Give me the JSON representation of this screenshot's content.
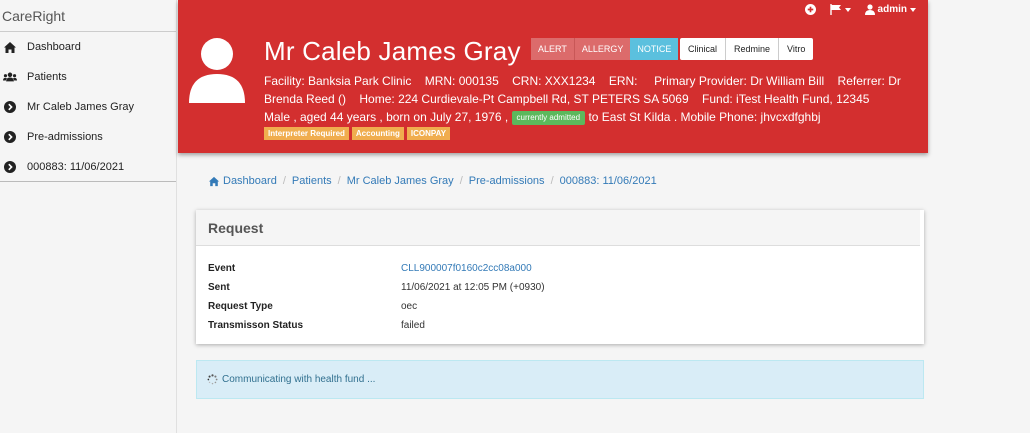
{
  "app": {
    "brand": "CareRight"
  },
  "sidebar": {
    "items": [
      {
        "label": "Dashboard",
        "icon": "home-icon"
      },
      {
        "label": "Patients",
        "icon": "users-icon"
      },
      {
        "label": "Mr Caleb James Gray",
        "icon": "chevron-circle-icon"
      },
      {
        "label": "Pre-admissions",
        "icon": "chevron-circle-icon"
      },
      {
        "label": "000883: 11/06/2021",
        "icon": "chevron-circle-icon"
      }
    ]
  },
  "topbar": {
    "user_label": "admin"
  },
  "patient": {
    "name": "Mr Caleb James Gray",
    "badges": {
      "alert": "ALERT",
      "allergy": "ALLERGY",
      "notice": "NOTICE"
    },
    "tabs": [
      "Clinical",
      "Redmine",
      "Vitro"
    ],
    "facility": "Facility: Banksia Park Clinic",
    "mrn": "MRN: 000135",
    "crn": "CRN: XXX1234",
    "ern": "ERN:",
    "primary_provider": "Primary Provider: Dr William Bill",
    "referrer": "Referrer: Dr Brenda Reed ()",
    "home": "Home: 224 Curdievale-Pt Campbell Rd, ST PETERS SA 5069",
    "fund": "Fund: iTest Health Fund, 12345",
    "demographics": "Male , aged 44 years , born on July 27, 1976 ,",
    "admitted_badge": "currently admitted",
    "location": "to East St Kilda . Mobile Phone: jhvcxdfghbj",
    "tags": [
      "Interpreter Required",
      "Accounting",
      "ICONPAY"
    ]
  },
  "breadcrumb": [
    "Dashboard",
    "Patients",
    "Mr Caleb James Gray",
    "Pre-admissions",
    "000883: 11/06/2021"
  ],
  "request": {
    "title": "Request",
    "rows": [
      {
        "label": "Event",
        "value": "CLL900007f0160c2cc08a000"
      },
      {
        "label": "Sent",
        "value": "11/06/2021 at 12:05 PM (+0930)"
      },
      {
        "label": "Request Type",
        "value": "oec"
      },
      {
        "label": "Transmisson Status",
        "value": "failed"
      }
    ]
  },
  "status_message": "Communicating with health fund ...",
  "colors": {
    "header_red": "#d32f2f",
    "notice_blue": "#5bc0de",
    "admitted_green": "#5cb85c",
    "tag_orange": "#f0ad4e",
    "link_blue": "#337ab7"
  }
}
